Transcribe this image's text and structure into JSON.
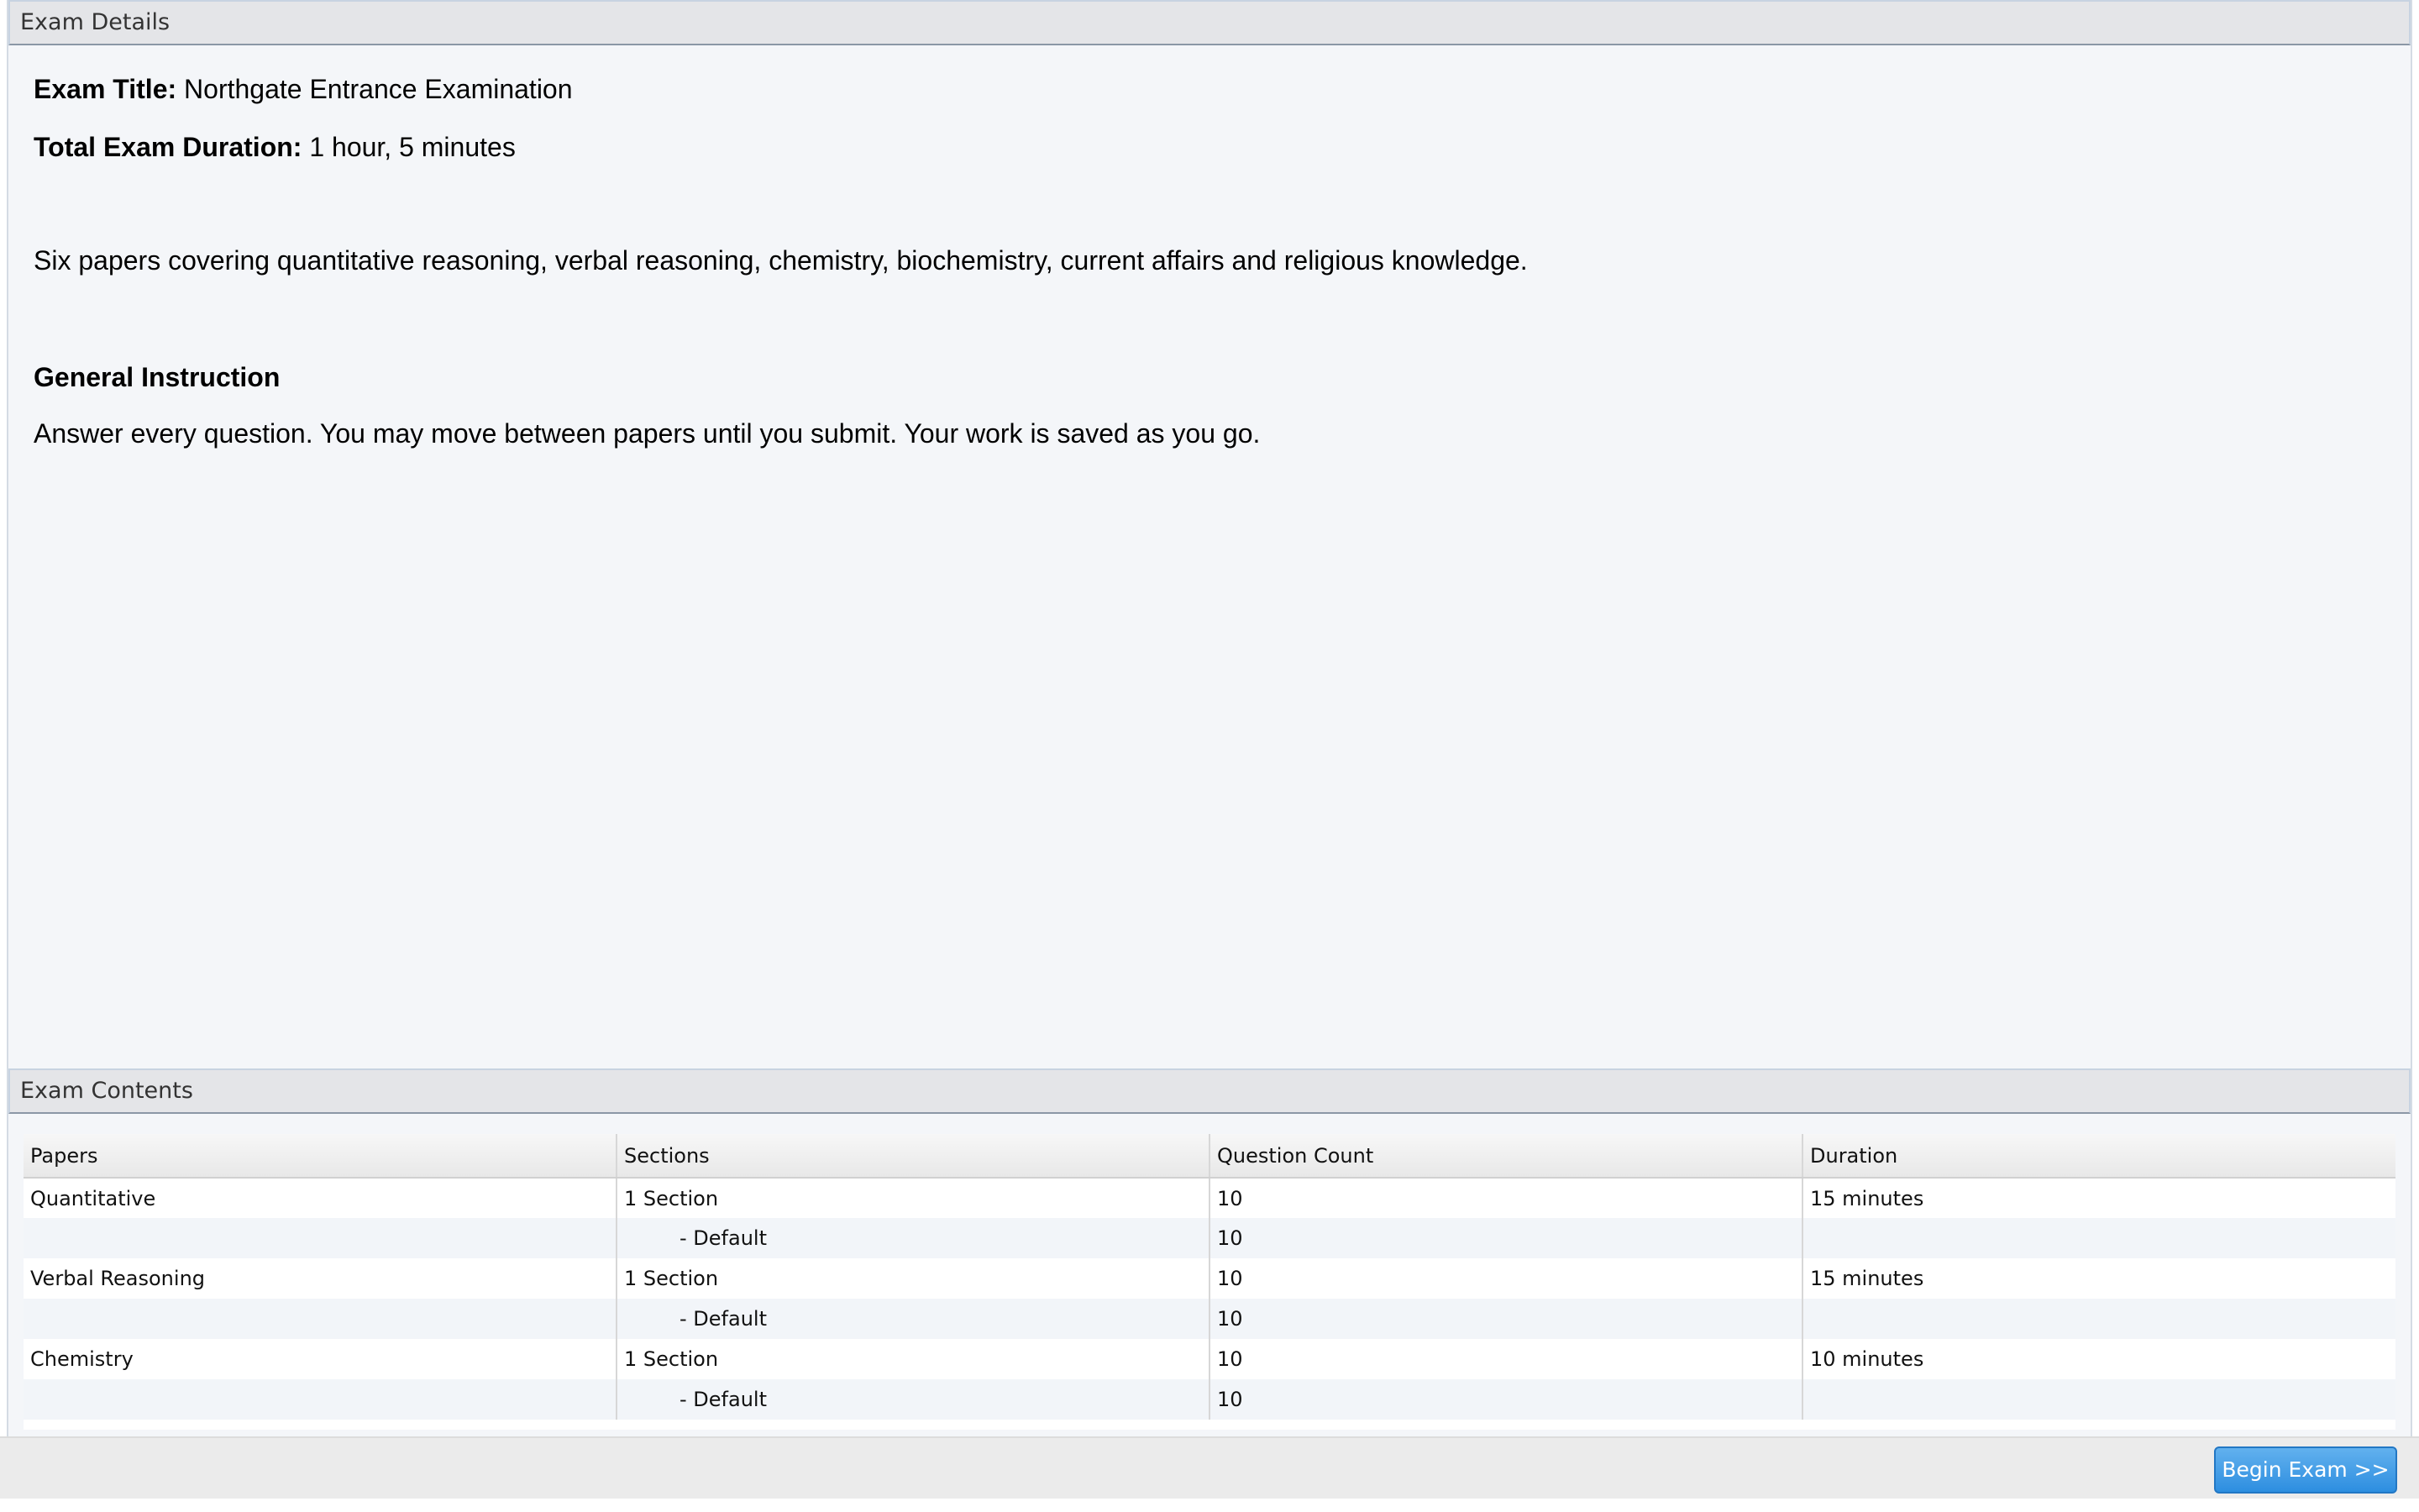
{
  "exam_details": {
    "header": "Exam Details",
    "title_label": "Exam Title:",
    "title_value": "Northgate Entrance Examination",
    "duration_label": "Total Exam Duration:",
    "duration_value": "1 hour, 5 minutes",
    "description": "Six papers covering quantitative reasoning, verbal reasoning, chemistry, biochemistry, current affairs and religious knowledge.",
    "general_instruction_heading": "General Instruction",
    "general_instruction_text": "Answer every question. You may move between papers until you submit. Your work is saved as you go."
  },
  "exam_contents": {
    "header": "Exam Contents",
    "columns": [
      "Papers",
      "Sections",
      "Question Count",
      "Duration"
    ],
    "rows": [
      {
        "paper": "Quantitative",
        "sections": "1 Section",
        "questions": "10",
        "duration": "15 minutes",
        "indent": false
      },
      {
        "paper": "",
        "sections": "- Default",
        "questions": "10",
        "duration": "",
        "indent": true
      },
      {
        "paper": "Verbal Reasoning",
        "sections": "1 Section",
        "questions": "10",
        "duration": "15 minutes",
        "indent": false
      },
      {
        "paper": "",
        "sections": "- Default",
        "questions": "10",
        "duration": "",
        "indent": true
      },
      {
        "paper": "Chemistry",
        "sections": "1 Section",
        "questions": "10",
        "duration": "10 minutes",
        "indent": false
      },
      {
        "paper": "",
        "sections": "- Default",
        "questions": "10",
        "duration": "",
        "indent": true
      }
    ]
  },
  "footer": {
    "begin_label": "Begin Exam >>"
  }
}
